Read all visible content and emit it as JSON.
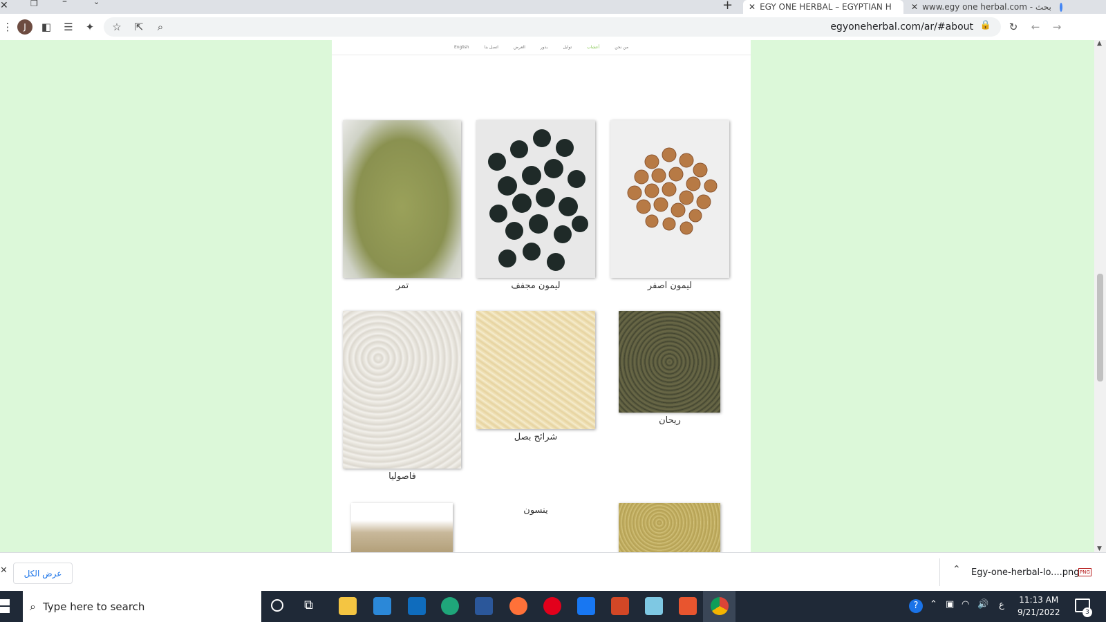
{
  "browser": {
    "tabs": [
      {
        "title": "EGY ONE HERBAL – EGYPTIAN H",
        "active": true
      },
      {
        "title": "www.egy one herbal.com - بحث",
        "active": false
      }
    ],
    "address": "egyoneherbal.com/ar/#about",
    "profile_initial": "J"
  },
  "site": {
    "nav": [
      "من نحن",
      "أعشاب",
      "توابل",
      "بذور",
      "العرض",
      "اتصل بنا",
      "English"
    ],
    "products": [
      {
        "name": "تمر"
      },
      {
        "name": "ليمون مجفف"
      },
      {
        "name": "ليمون اصفر"
      },
      {
        "name": "فاصوليا"
      },
      {
        "name": "شرائح بصل"
      },
      {
        "name": "ريحان"
      },
      {
        "name": "ينسون"
      }
    ]
  },
  "downloads": {
    "show_all": "عرض الكل",
    "file": "Egy-one-herbal-lo....png",
    "file_type": "PNG"
  },
  "taskbar": {
    "search_placeholder": "Type here to search",
    "time": "11:13 AM",
    "date": "9/21/2022",
    "lang": "ع",
    "notifications": "3"
  },
  "colors": {
    "page_background": "#dcf8d9",
    "accent_green": "#7ac142",
    "taskbar": "#1f2937"
  }
}
